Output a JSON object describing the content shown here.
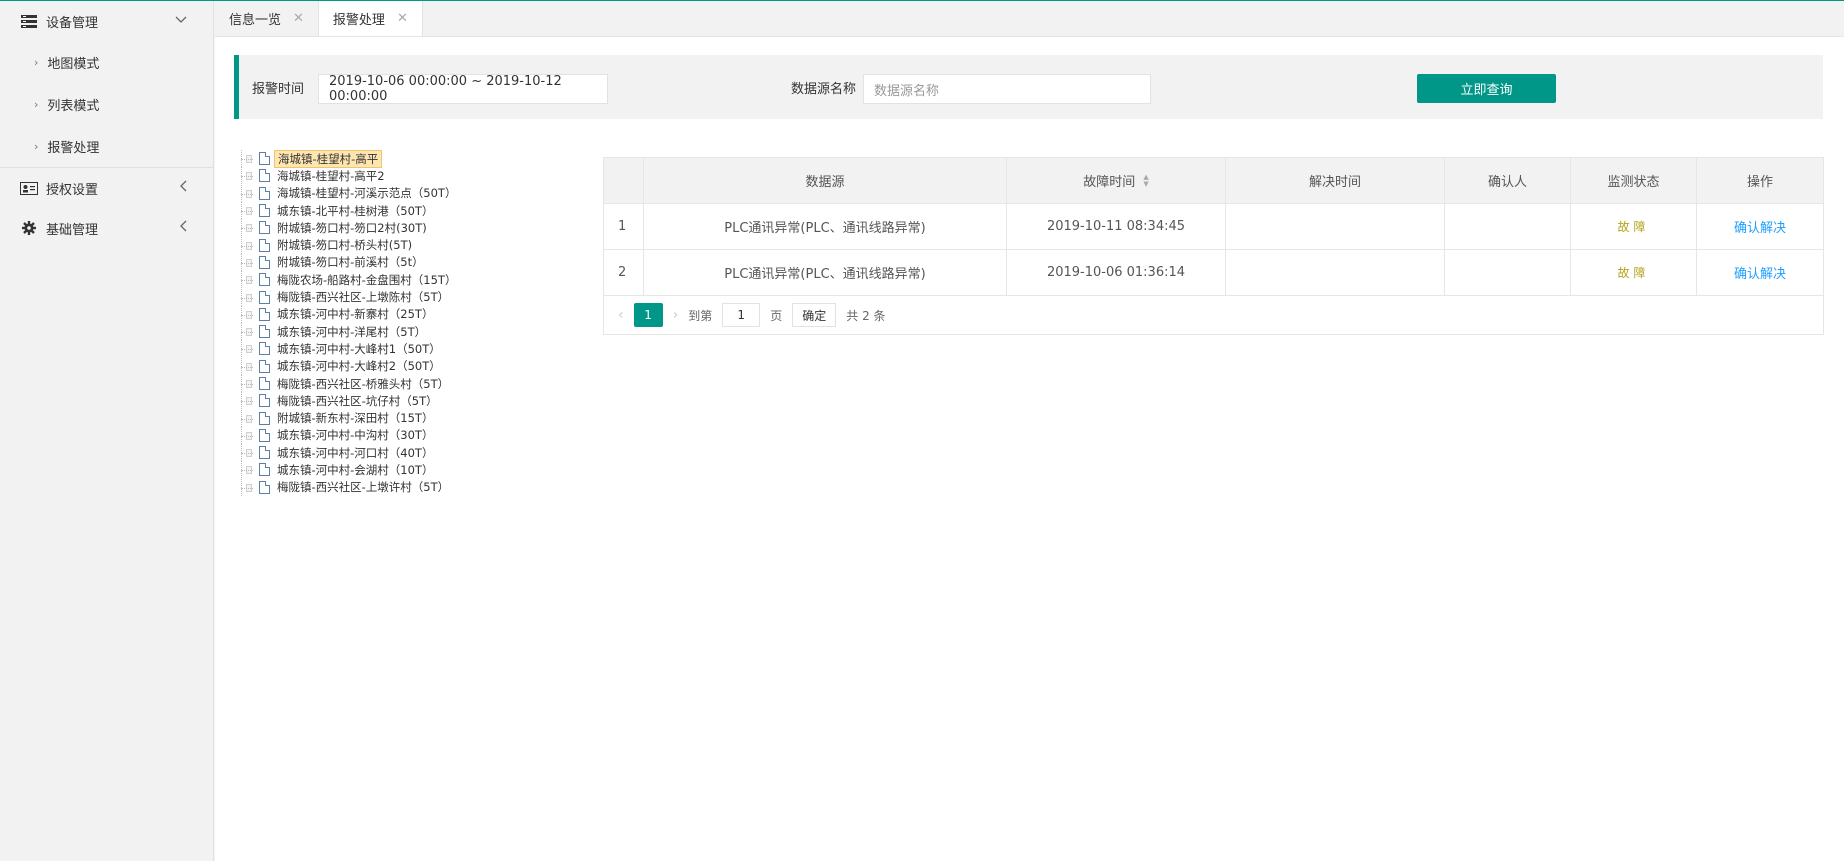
{
  "sidebar": {
    "groups": [
      {
        "label": "设备管理",
        "icon": "list-icon",
        "expanded": true,
        "items": [
          {
            "label": "地图模式"
          },
          {
            "label": "列表模式"
          },
          {
            "label": "报警处理"
          }
        ]
      },
      {
        "label": "授权设置",
        "icon": "id-card-icon",
        "expanded": false
      },
      {
        "label": "基础管理",
        "icon": "gear-icon",
        "expanded": false
      }
    ]
  },
  "tabs": [
    {
      "label": "信息一览",
      "active": false
    },
    {
      "label": "报警处理",
      "active": true
    }
  ],
  "filter": {
    "alarm_time_label": "报警时间",
    "alarm_time_value": "2019-10-06 00:00:00 ~ 2019-10-12 00:00:00",
    "source_name_label": "数据源名称",
    "source_name_placeholder": "数据源名称",
    "query_button": "立即查询"
  },
  "tree": [
    "海城镇-桂望村-高平",
    "海城镇-桂望村-高平2",
    "海城镇-桂望村-河溪示范点（50T）",
    "城东镇-北平村-桂树港（50T）",
    "附城镇-笏口村-笏口2村(30T)",
    "附城镇-笏口村-桥头村(5T)",
    "附城镇-笏口村-前溪村（5t）",
    "梅陇农场-船路村-金盘围村（15T）",
    "梅陇镇-西兴社区-上墩陈村（5T）",
    "城东镇-河中村-新寨村（25T）",
    "城东镇-河中村-洋尾村（5T）",
    "城东镇-河中村-大峰村1（50T）",
    "城东镇-河中村-大峰村2（50T）",
    "梅陇镇-西兴社区-桥雅头村（5T）",
    "梅陇镇-西兴社区-坑仔村（5T）",
    "附城镇-新东村-深田村（15T）",
    "城东镇-河中村-中沟村（30T）",
    "城东镇-河中村-河口村（40T）",
    "城东镇-河中村-会湖村（10T）",
    "梅陇镇-西兴社区-上墩许村（5T）"
  ],
  "table": {
    "headers": [
      "",
      "数据源",
      "故障时间",
      "解决时间",
      "确认人",
      "监测状态",
      "操作"
    ],
    "rows": [
      {
        "index": "1",
        "source": "PLC通讯异常(PLC、通讯线路异常)",
        "fault_time": "2019-10-11 08:34:45",
        "resolve_time": "",
        "confirmer": "",
        "status": "故障",
        "action": "确认解决"
      },
      {
        "index": "2",
        "source": "PLC通讯异常(PLC、通讯线路异常)",
        "fault_time": "2019-10-06 01:36:14",
        "resolve_time": "",
        "confirmer": "",
        "status": "故障",
        "action": "确认解决"
      }
    ]
  },
  "pager": {
    "current": "1",
    "goto_label": "到第",
    "goto_value": "1",
    "page_unit": "页",
    "confirm": "确定",
    "total": "共 2 条"
  },
  "colors": {
    "accent": "#009688",
    "link": "#1e9fff",
    "fault": "#b5a31a"
  }
}
